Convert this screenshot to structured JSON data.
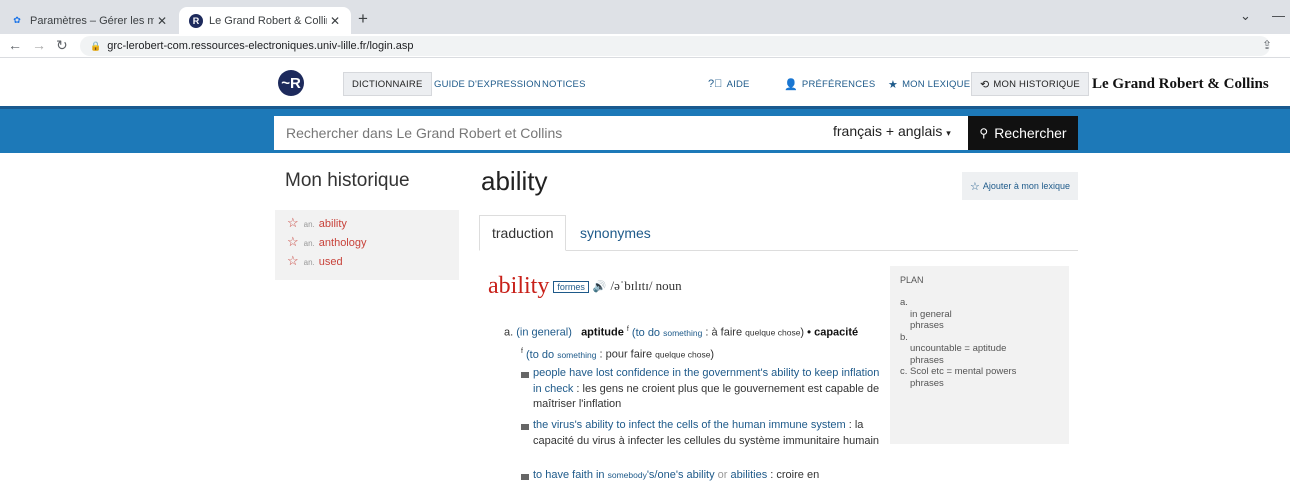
{
  "browser": {
    "tabs": [
      {
        "title": "Paramètres – Gérer les moteurs d",
        "close": "✕",
        "active": false
      },
      {
        "title": "Le Grand Robert & Collins",
        "close": "✕",
        "active": true
      }
    ],
    "newtab": "+",
    "url": "grc-lerobert-com.ressources-electroniques.univ-lille.fr/login.asp"
  },
  "header": {
    "logo": "~R",
    "nav": [
      {
        "label": "DICTIONNAIRE"
      },
      {
        "label": "GUIDE D'EXPRESSION"
      },
      {
        "label": "NOTICES"
      }
    ],
    "right_nav": [
      {
        "label": "AIDE",
        "icon": "help-icon"
      },
      {
        "label": "PRÉFÉRENCES",
        "icon": "user-icon"
      },
      {
        "label": "MON LEXIQUE",
        "icon": "star-icon"
      },
      {
        "label": "MON HISTORIQUE",
        "icon": "history-icon"
      }
    ],
    "brand": "Le Grand Robert & Collins"
  },
  "search": {
    "placeholder": "Rechercher dans Le Grand Robert et Collins",
    "language": "français + anglais",
    "button_label": "Rechercher"
  },
  "sidebar": {
    "title": "Mon historique",
    "items": [
      {
        "pos": "an.",
        "word": "ability"
      },
      {
        "pos": "an.",
        "word": "anthology"
      },
      {
        "pos": "an.",
        "word": "used"
      }
    ]
  },
  "entry": {
    "title": "ability",
    "add_lexicon": "Ajouter à mon lexique",
    "tabs": [
      "traduction",
      "synonymes"
    ],
    "headword": "ability",
    "formes": "formes",
    "pronunciation": "/əˈbɪlɪtɪ/ noun",
    "sense_a": {
      "letter": "a.",
      "label": "(in general)",
      "t1": "aptitude",
      "g1": "f",
      "c1a": "(to do ",
      "c1b": "something",
      "c1c": " : à faire ",
      "c1d": "quelque chose",
      "c1e": ")",
      "dot": "•",
      "t2": "capacité",
      "g2": "f",
      "c2a": "(to do ",
      "c2b": "something",
      "c2c": " : pour faire ",
      "c2d": "quelque chose",
      "c2e": ")"
    },
    "examples": [
      {
        "src": "people have lost confidence in the government's ability to keep inflation in check",
        "sep": " : ",
        "tr": "les gens ne croient plus que le gouvernement est capable de maîtriser l'inflation"
      },
      {
        "src": "the virus's ability to infect the cells of the human immune system",
        "sep": " : ",
        "tr": "la capacité du virus à infecter les cellules du système immunitaire humain"
      },
      {
        "src_a": "to have faith in ",
        "src_b": "somebody",
        "src_c": "'s/one's ability",
        "or": " or ",
        "src_d": "abilities",
        "sep": " : ",
        "tr": "croire en"
      }
    ]
  },
  "plan": {
    "title": "PLAN",
    "rows": [
      {
        "text": "a.",
        "indent": false
      },
      {
        "text": "in general",
        "indent": true
      },
      {
        "text": "phrases",
        "indent": true
      },
      {
        "text": "b.",
        "indent": false
      },
      {
        "text": "uncountable = aptitude",
        "indent": true
      },
      {
        "text": "phrases",
        "indent": true
      },
      {
        "text": "c. Scol etc = mental powers",
        "indent": false
      },
      {
        "text": "phrases",
        "indent": true
      }
    ]
  }
}
